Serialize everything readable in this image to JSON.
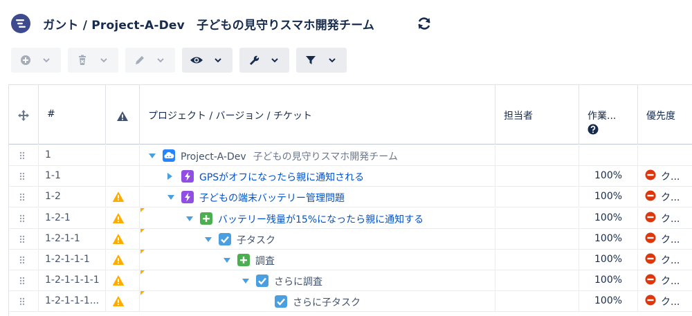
{
  "header": {
    "title": "ガント / Project-A-Dev　子どもの見守りスマホ開発チーム",
    "app_icon": "gantt-app-icon",
    "refresh_icon": "refresh-icon"
  },
  "toolbar": [
    {
      "name": "add-menu-button",
      "icon": "plus-circle-icon",
      "enabled": false
    },
    {
      "name": "delete-menu-button",
      "icon": "trash-icon",
      "enabled": false
    },
    {
      "name": "edit-menu-button",
      "icon": "pencil-icon",
      "enabled": false
    },
    {
      "name": "view-menu-button",
      "icon": "eye-icon",
      "enabled": true
    },
    {
      "name": "tools-menu-button",
      "icon": "wrench-icon",
      "enabled": true
    },
    {
      "name": "filter-menu-button",
      "icon": "filter-icon",
      "enabled": true
    }
  ],
  "columns": {
    "drag": "",
    "number": "#",
    "warning": "",
    "name": "プロジェクト / バージョン / チケット",
    "assignee": "担当者",
    "progress": "作業...",
    "priority": "優先度"
  },
  "rows": [
    {
      "num": "1",
      "warn": false,
      "level": 0,
      "toggle": "down",
      "icon": "project",
      "label": "Project-A-Dev",
      "sub": "子どもの見守りスマホ開発チーム",
      "link": false,
      "progress": "",
      "priority": ""
    },
    {
      "num": "1-1",
      "warn": false,
      "level": 1,
      "toggle": "right",
      "icon": "epic",
      "label": "GPSがオフになったら親に通知される",
      "sub": "",
      "link": true,
      "progress": "100%",
      "priority": "ク..."
    },
    {
      "num": "1-2",
      "warn": true,
      "level": 1,
      "toggle": "down",
      "icon": "epic",
      "label": "子どもの端末バッテリー管理問題",
      "sub": "",
      "link": true,
      "progress": "100%",
      "priority": "ク..."
    },
    {
      "num": "1-2-1",
      "warn": true,
      "level": 2,
      "toggle": "down",
      "icon": "story",
      "label": "バッテリー残量が15%になったら親に通知する",
      "sub": "",
      "link": true,
      "progress": "100%",
      "priority": "ク..."
    },
    {
      "num": "1-2-1-1",
      "warn": true,
      "level": 3,
      "toggle": "down",
      "icon": "task",
      "label": "子タスク",
      "sub": "",
      "link": false,
      "progress": "100%",
      "priority": "ク..."
    },
    {
      "num": "1-2-1-1-1",
      "warn": true,
      "level": 4,
      "toggle": "down",
      "icon": "story",
      "label": "調査",
      "sub": "",
      "link": false,
      "progress": "100%",
      "priority": "ク..."
    },
    {
      "num": "1-2-1-1-1-1",
      "warn": true,
      "level": 5,
      "toggle": "down",
      "icon": "task",
      "label": "さらに調査",
      "sub": "",
      "link": false,
      "progress": "100%",
      "priority": "ク..."
    },
    {
      "num": "1-2-1-1-1...",
      "warn": true,
      "level": 6,
      "toggle": "none",
      "icon": "task",
      "label": "さらに子タスク",
      "sub": "",
      "link": false,
      "progress": "100%",
      "priority": "ク..."
    }
  ],
  "colors": {
    "epic": "#904ee2",
    "story": "#4bae4f",
    "task": "#4a9fe0",
    "project": "#2684ff",
    "warning": "#ffab00",
    "priority": "#de350b",
    "link": "#0052cc"
  }
}
